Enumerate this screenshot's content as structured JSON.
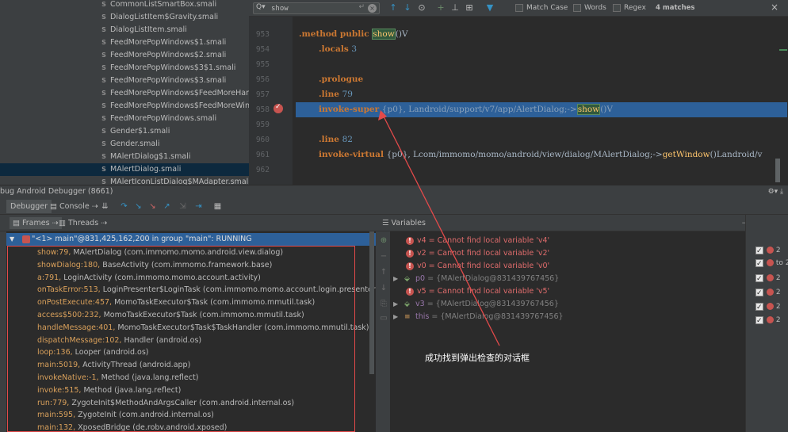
{
  "project_tree": {
    "items": [
      {
        "label": "CommonListSmartBox.smali",
        "selected": false
      },
      {
        "label": "DialogListItem$Gravity.smali",
        "selected": false
      },
      {
        "label": "DialogListItem.smali",
        "selected": false
      },
      {
        "label": "FeedMorePopWindows$1.smali",
        "selected": false
      },
      {
        "label": "FeedMorePopWindows$2.smali",
        "selected": false
      },
      {
        "label": "FeedMorePopWindows$3$1.smali",
        "selected": false
      },
      {
        "label": "FeedMorePopWindows$3.smali",
        "selected": false
      },
      {
        "label": "FeedMorePopWindows$FeedMoreHanc",
        "selected": false
      },
      {
        "label": "FeedMorePopWindows$FeedMoreWinc",
        "selected": false
      },
      {
        "label": "FeedMorePopWindows.smali",
        "selected": false
      },
      {
        "label": "Gender$1.smali",
        "selected": false
      },
      {
        "label": "Gender.smali",
        "selected": false
      },
      {
        "label": "MAlertDialog$1.smali",
        "selected": false
      },
      {
        "label": "MAlertDialog.smali",
        "selected": true
      },
      {
        "label": "MAlertIconListDialog$MAdapter.smali",
        "selected": false
      }
    ],
    "file_icon": "S"
  },
  "find_bar": {
    "search_value": "show",
    "match_case_label": "Match Case",
    "words_label": "Words",
    "regex_label": "Regex",
    "matches_label": "4 matches"
  },
  "editor": {
    "line_numbers": [
      "953",
      "954",
      "955",
      "956",
      "957",
      "958",
      "959",
      "960",
      "961",
      "962"
    ],
    "lines": {
      "l953_kw": ".method public ",
      "l953_match": "show",
      "l953_rest": "()V",
      "l954_kw": ".locals ",
      "l954_num": "3",
      "l956_kw": ".prologue",
      "l957_kw": ".line ",
      "l957_num": "79",
      "l958_kw": "invoke-super ",
      "l958_args": "{p0}, Landroid/support/v7/app/AlertDialog;->",
      "l958_match": "show",
      "l958_rest": "()V",
      "l960_kw": ".line ",
      "l960_num": "82",
      "l961_kw": "invoke-virtual ",
      "l961_args": "{p0}, Lcom/immomo/momo/android/view/dialog/MAlertDialog;->",
      "l961_fn": "getWindow",
      "l961_rest": "()Landroid/v"
    }
  },
  "debug_panel": {
    "title": "bug  Android Debugger (8661)",
    "tabs": {
      "debugger": "Debugger",
      "console": "Console"
    },
    "frames_tab": "Frames",
    "threads_tab": "Threads",
    "variables_tab": "Variables",
    "thread_label": "\"<1> main\"@831,425,162,200 in group \"main\": RUNNING",
    "frames": [
      {
        "method": "show:79,",
        "rest": " MAlertDialog (com.immomo.momo.android.view.dialog)"
      },
      {
        "method": "showDialog:180,",
        "rest": " BaseActivity (com.immomo.framework.base)"
      },
      {
        "method": "a:791,",
        "rest": " LoginActivity (com.immomo.momo.account.activity)"
      },
      {
        "method": "onTaskError:513,",
        "rest": " LoginPresenter$LoginTask (com.immomo.momo.account.login.presenter)"
      },
      {
        "method": "onPostExecute:457,",
        "rest": " MomoTaskExecutor$Task (com.immomo.mmutil.task)"
      },
      {
        "method": "access$500:232,",
        "rest": " MomoTaskExecutor$Task (com.immomo.mmutil.task)"
      },
      {
        "method": "handleMessage:401,",
        "rest": " MomoTaskExecutor$Task$TaskHandler (com.immomo.mmutil.task)"
      },
      {
        "method": "dispatchMessage:102,",
        "rest": " Handler (android.os)"
      },
      {
        "method": "loop:136,",
        "rest": " Looper (android.os)"
      },
      {
        "method": "main:5019,",
        "rest": " ActivityThread (android.app)"
      },
      {
        "method": "invokeNative:-1,",
        "rest": " Method (java.lang.reflect)"
      },
      {
        "method": "invoke:515,",
        "rest": " Method (java.lang.reflect)"
      },
      {
        "method": "run:779,",
        "rest": " ZygoteInit$MethodAndArgsCaller (com.android.internal.os)"
      },
      {
        "method": "main:595,",
        "rest": " ZygoteInit (com.android.internal.os)"
      },
      {
        "method": "main:132,",
        "rest": " XposedBridge (de.robv.android.xposed)"
      }
    ],
    "variables": {
      "errors": [
        "v4 = Cannot find local variable 'v4'",
        "v2 = Cannot find local variable 'v2'",
        "v0 = Cannot find local variable 'v0'"
      ],
      "p0_name": "p0",
      "p0_value": " = {MAlertDialog@831439767456}",
      "v5_error": "v5 = Cannot find local variable 'v5'",
      "v3_name": "v3",
      "v3_value": " = {MAlertDialog@831439767456}",
      "this_name": "this",
      "this_value": " = {MAlertDialog@831439767456}"
    },
    "annotation": "成功找到弹出检查的对话框",
    "right_panel": [
      "2",
      "to 2",
      "2",
      "2",
      "2",
      "2"
    ]
  }
}
